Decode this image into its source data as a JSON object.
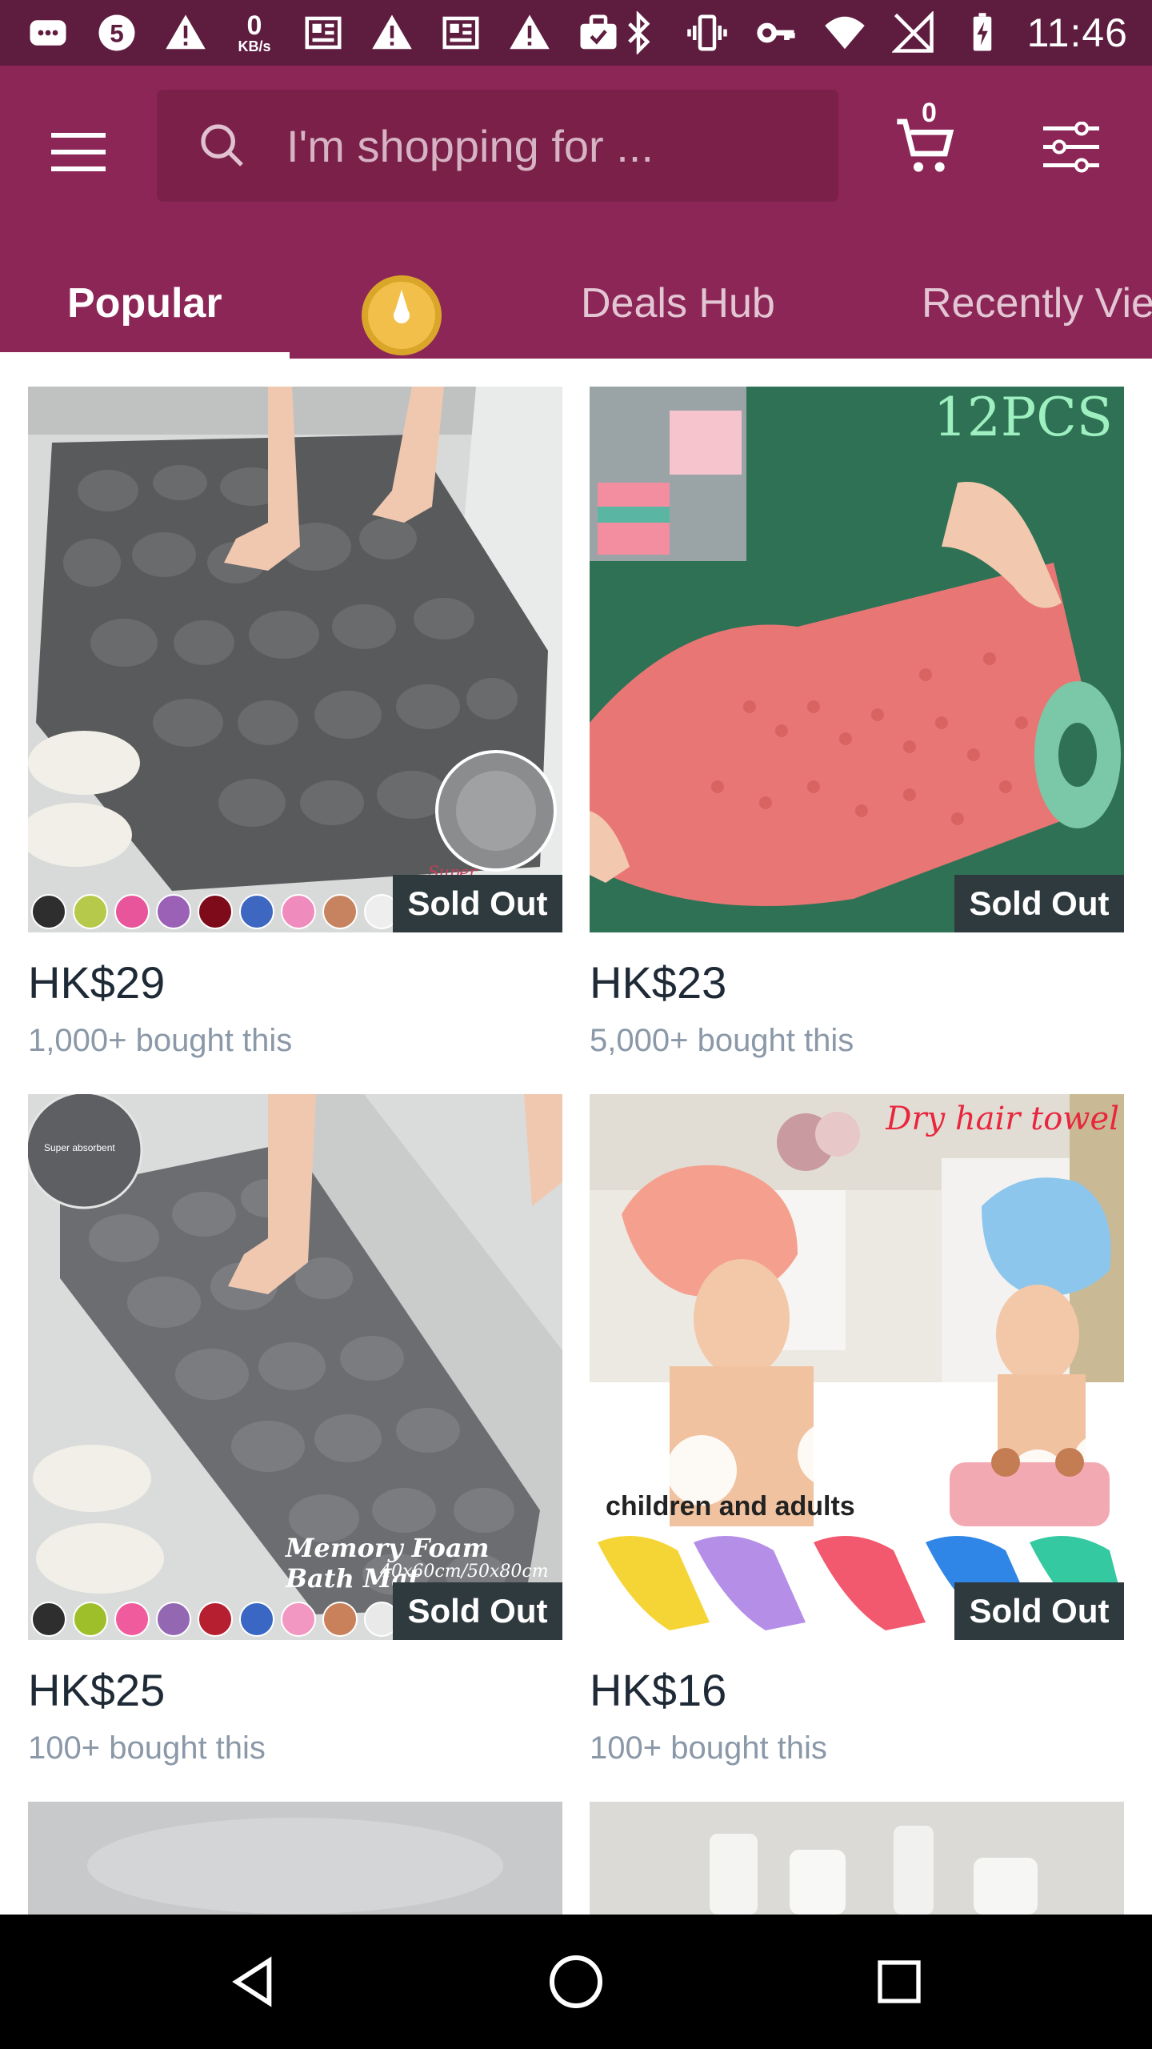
{
  "status_bar": {
    "speed_value": "0",
    "speed_unit": "KB/s",
    "time": "11:46",
    "icons_left": [
      "messages-icon",
      "app-5-icon",
      "warning-icon",
      "news-icon",
      "warning-icon",
      "news-icon",
      "warning-icon",
      "briefcase-icon"
    ],
    "icons_right": [
      "bluetooth-icon",
      "vibrate-icon",
      "vpn-key-icon",
      "wifi-icon",
      "no-signal-icon",
      "battery-charging-icon"
    ]
  },
  "header": {
    "search_placeholder": "I'm shopping for ...",
    "cart_count": "0",
    "tabs": [
      {
        "label": "Popular",
        "active": true
      },
      {
        "label": "Deals Hub",
        "active": false
      },
      {
        "label": "Recently Vie",
        "active": false
      }
    ],
    "colors": {
      "brand": "#8c2657",
      "status_bar": "#5e1d3f"
    }
  },
  "products": [
    {
      "price": "HK$29",
      "bought": "1,000+ bought this",
      "badge": "Sold Out",
      "image_text": "Super absorbent",
      "swatches": [
        "#2e2e2e",
        "#b7c94a",
        "#e8559a",
        "#9a61b6",
        "#7d0b1a",
        "#3e67c2",
        "#f08cbd",
        "#c7835f",
        "#eeeeee"
      ]
    },
    {
      "price": "HK$23",
      "bought": "5,000+ bought this",
      "badge": "Sold Out",
      "image_text": "12PCS"
    },
    {
      "price": "HK$25",
      "bought": "100+ bought this",
      "badge": "Sold Out",
      "image_text": "Memory Foam Bath Mat",
      "image_subtext": "40x60cm/50x80cm",
      "image_corner_text": "Super absorbent",
      "swatches": [
        "#2e2e2e",
        "#9fbf2a",
        "#ef5b9c",
        "#9467b3",
        "#b51f2f",
        "#3a67c4",
        "#f296c2",
        "#c9815c",
        "#e9e9e9"
      ]
    },
    {
      "price": "HK$16",
      "bought": "100+ bought this",
      "badge": "Sold Out",
      "image_text": "Dry hair towel",
      "image_subtext": "children and adults"
    }
  ]
}
